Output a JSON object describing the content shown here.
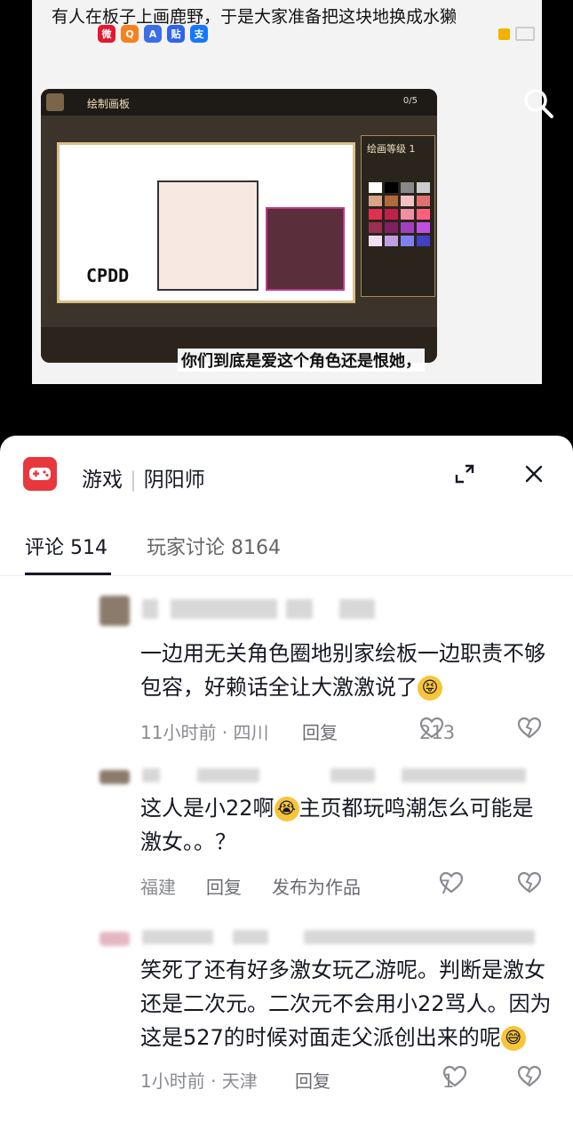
{
  "video": {
    "title": "有人在板子上画鹿野，于是大家准备把这块地换成水獭",
    "app_icons": [
      {
        "name": "weibo",
        "glyph": "微",
        "color": "#e6162d"
      },
      {
        "name": "qq",
        "glyph": "Q",
        "color": "#f58220"
      },
      {
        "name": "mixed",
        "glyph": "A",
        "color": "#3b6ee8"
      },
      {
        "name": "tieba",
        "glyph": "贴",
        "color": "#2d64f0"
      },
      {
        "name": "alipay",
        "glyph": "支",
        "color": "#1677ff"
      }
    ],
    "game_header": "绘制画板",
    "game_count": "0/5",
    "palette_header": "绘画等级 1",
    "canvas_text": "CPDD",
    "subtitle": "你们到底是爱这个角色还是恨她，",
    "palette_colors": [
      "#ffffff",
      "#000000",
      "#888888",
      "#cccccc",
      "#d9a589",
      "#b06a3e",
      "#f2c1c1",
      "#e07070",
      "#e03050",
      "#c0204a",
      "#f090a0",
      "#ff6080",
      "#9a3050",
      "#802060",
      "#a040c0",
      "#c050e0",
      "#f0e0f0",
      "#c0a0e0",
      "#8080f0",
      "#4040c0"
    ]
  },
  "panel": {
    "category": "游戏",
    "game_name": "阴阳师",
    "tabs": [
      {
        "label": "评论 514",
        "active": true
      },
      {
        "label": "玩家讨论 8164",
        "active": false
      }
    ]
  },
  "comments": [
    {
      "text_1": "一边用无关角色圈地别家绘板一边职责不够包容，好赖话全让大激激说了",
      "emoji": "😝",
      "time": "11小时前 · 四川",
      "reply": "回复",
      "likes": "213"
    },
    {
      "text_1": "这人是小22啊",
      "emoji": "😭",
      "text_2": "主页都玩鸣潮怎么可能是激女。。？",
      "location": "福建",
      "reply": "回复",
      "publish": "发布为作品",
      "likes": "7"
    },
    {
      "text_1": "笑死了还有好多激女玩乙游呢。判断是激女还是二次元。二次元不会用小22骂人。因为这是527的时候对面走父派创出来的呢",
      "emoji": "😅",
      "time": "1小时前 · 天津",
      "reply": "回复",
      "likes": "1"
    }
  ]
}
